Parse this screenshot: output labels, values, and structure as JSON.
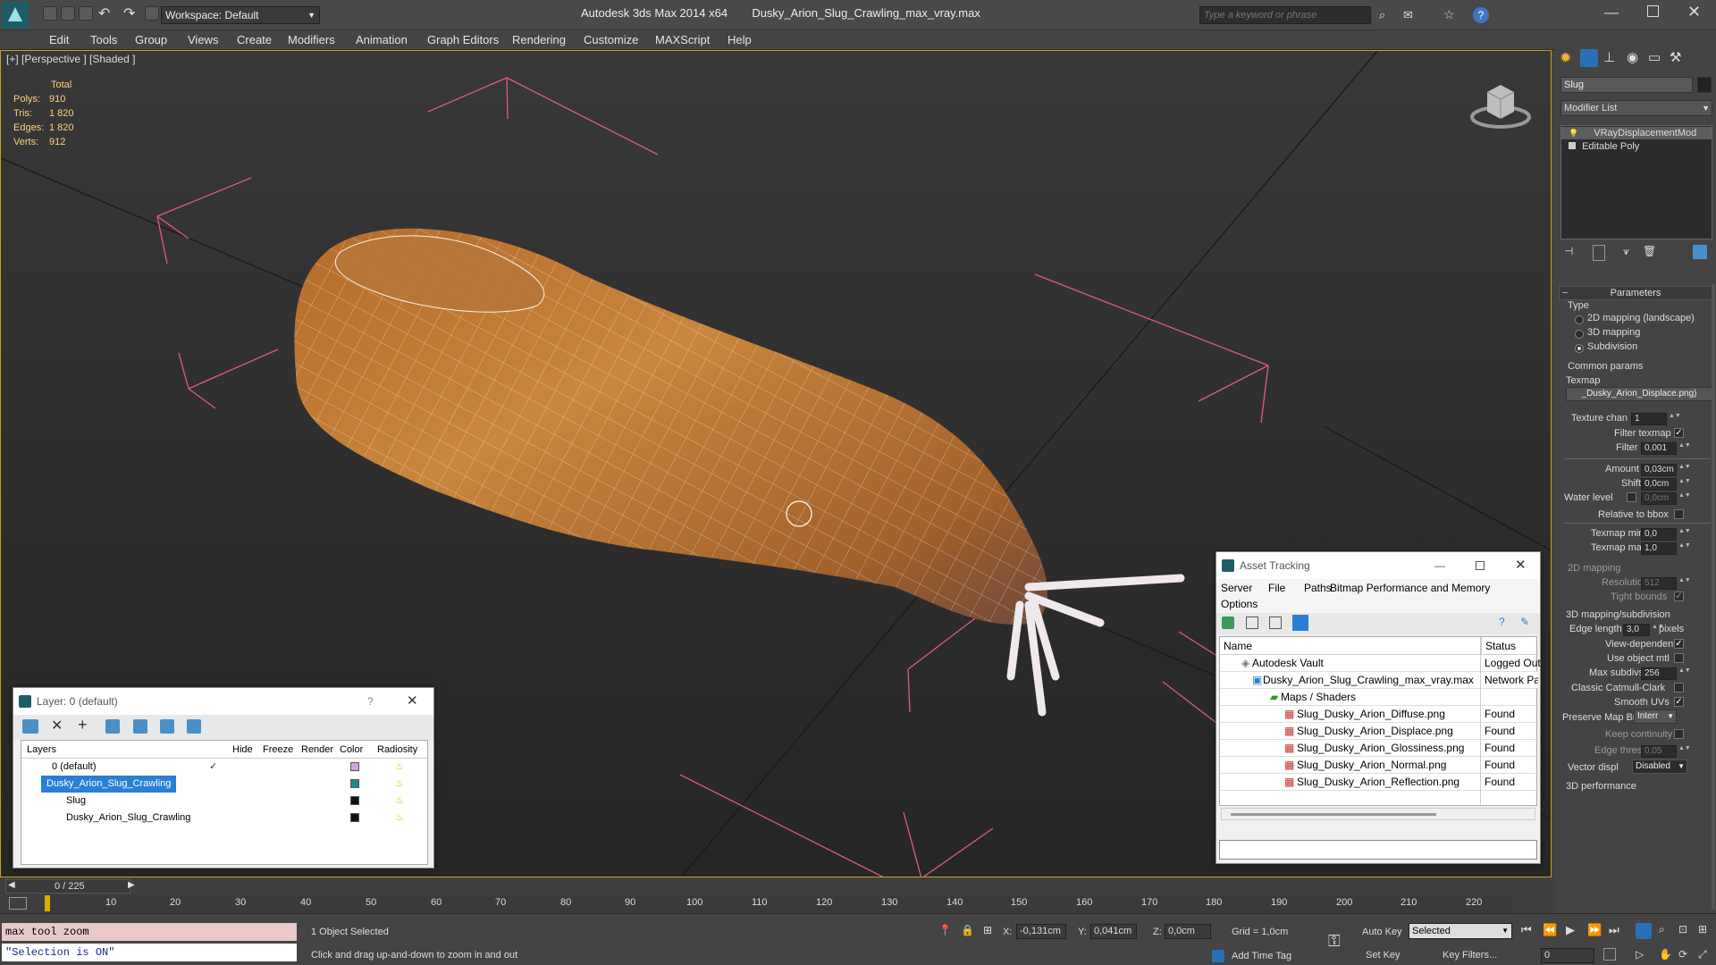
{
  "app": {
    "title": "Autodesk 3ds Max  2014 x64",
    "file": "Dusky_Arion_Slug_Crawling_max_vray.max",
    "workspace": "Workspace: Default",
    "search_placeholder": "Type a keyword or phrase"
  },
  "menu": [
    "Edit",
    "Tools",
    "Group",
    "Views",
    "Create",
    "Modifiers",
    "Animation",
    "Graph Editors",
    "Rendering",
    "Customize",
    "MAXScript",
    "Help"
  ],
  "viewport": {
    "label": "[+] [Perspective ] [Shaded ]",
    "stats": {
      "total_label": "Total",
      "rows": [
        {
          "label": "Polys:",
          "value": "910"
        },
        {
          "label": "Tris:",
          "value": "1 820"
        },
        {
          "label": "Edges:",
          "value": "1 820"
        },
        {
          "label": "Verts:",
          "value": "912"
        }
      ]
    }
  },
  "layer_dialog": {
    "title": "Layer: 0 (default)",
    "help": "?",
    "columns": [
      "Layers",
      "Hide",
      "Freeze",
      "Render",
      "Color",
      "Radiosity"
    ],
    "rows": [
      {
        "name": "0 (default)",
        "color": "#c7a8e0"
      },
      {
        "name": "Dusky_Arion_Slug_Crawling",
        "color": "#1a8c8c",
        "selected": true
      },
      {
        "name": "Slug",
        "color": "#111111"
      },
      {
        "name": "Dusky_Arion_Slug_Crawling",
        "color": "#111111"
      }
    ]
  },
  "asset_dialog": {
    "title": "Asset Tracking",
    "menu": [
      "Server",
      "File",
      "Paths",
      "Bitmap Performance and Memory",
      "Options"
    ],
    "columns": [
      "Name",
      "Status"
    ],
    "rows": [
      {
        "name": "Autodesk Vault",
        "status": "Logged Out",
        "indent": 0
      },
      {
        "name": "Dusky_Arion_Slug_Crawling_max_vray.max",
        "status": "Network Pa",
        "indent": 1
      },
      {
        "name": "Maps / Shaders",
        "status": "",
        "indent": 2
      },
      {
        "name": "Slug_Dusky_Arion_Diffuse.png",
        "status": "Found",
        "indent": 3
      },
      {
        "name": "Slug_Dusky_Arion_Displace.png",
        "status": "Found",
        "indent": 3
      },
      {
        "name": "Slug_Dusky_Arion_Glossiness.png",
        "status": "Found",
        "indent": 3
      },
      {
        "name": "Slug_Dusky_Arion_Normal.png",
        "status": "Found",
        "indent": 3
      },
      {
        "name": "Slug_Dusky_Arion_Reflection.png",
        "status": "Found",
        "indent": 3
      }
    ]
  },
  "command_panel": {
    "object_name": "Slug",
    "modifier_list": "Modifier List",
    "stack": [
      "VRayDisplacementMod",
      "Editable Poly"
    ],
    "rollout_title": "Parameters",
    "type_label": "Type",
    "type_options": [
      "2D mapping (landscape)",
      "3D mapping",
      "Subdivision"
    ],
    "common_params": "Common params",
    "texmap_label": "Texmap",
    "texmap_value": "_Dusky_Arion_Displace.png)",
    "texture_chan_label": "Texture chan",
    "texture_chan_value": "1",
    "filter_texmap": "Filter texmap",
    "filter_blur_label": "Filter blur",
    "filter_blur_value": "0,001",
    "amount_label": "Amount",
    "amount_value": "0,03cm",
    "shift_label": "Shift",
    "shift_value": "0,0cm",
    "water_label": "Water level",
    "water_value": "0,0cm",
    "relative_bbox": "Relative to bbox",
    "texmap_min_label": "Texmap min",
    "texmap_min_value": "0,0",
    "texmap_max_label": "Texmap max",
    "texmap_max_value": "1,0",
    "mapping2d_title": "2D mapping",
    "resolution_label": "Resolution",
    "resolution_value": "512",
    "tight_bounds": "Tight bounds",
    "mapping3d_title": "3D mapping/subdivision",
    "edge_length_label": "Edge length",
    "edge_length_value": "3,0",
    "pixels": "pixels",
    "view_dependent": "View-dependent",
    "use_object_mtl": "Use object mtl",
    "max_subdivs_label": "Max subdivs",
    "max_subdivs_value": "256",
    "catmull": "Classic Catmull-Clark",
    "smooth_uvs": "Smooth UVs",
    "preserve_label": "Preserve Map Bnd",
    "preserve_value": "Interr",
    "keep_continuity": "Keep continuity",
    "edge_thresh_label": "Edge thresh",
    "edge_thresh_value": "0,05",
    "vector_label": "Vector displ",
    "vector_value": "Disabled",
    "perf_title": "3D performance"
  },
  "timeline": {
    "slider": "0 / 225",
    "ticks": [
      "10",
      "20",
      "30",
      "40",
      "50",
      "60",
      "70",
      "80",
      "90",
      "100",
      "110",
      "120",
      "130",
      "140",
      "150",
      "160",
      "170",
      "180",
      "190",
      "200",
      "210",
      "220"
    ]
  },
  "status": {
    "script_line1": "max tool zoom",
    "script_line2": "\"Selection is ON\"",
    "selected": "1 Object Selected",
    "prompt": "Click and drag up-and-down to zoom in and out",
    "x_label": "X:",
    "x_value": "-0,131cm",
    "y_label": "Y:",
    "y_value": "0,041cm",
    "z_label": "Z:",
    "z_value": "0,0cm",
    "grid": "Grid = 1,0cm",
    "add_time_tag": "Add Time Tag",
    "auto_key": "Auto Key",
    "set_key": "Set Key",
    "key_mode": "Selected",
    "key_filters": "Key Filters...",
    "frame": "0"
  }
}
